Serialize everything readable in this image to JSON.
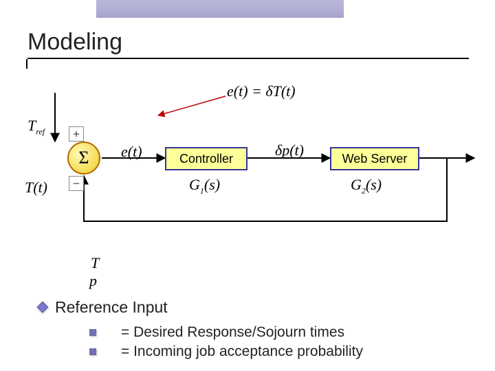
{
  "title": "Modeling",
  "diagram": {
    "sum_symbol": "Σ",
    "plus_sign": "+",
    "minus_sign": "−",
    "ref_input_label_html": "T<sub>ref</sub>",
    "feedback_label_html": "T(t)",
    "error_label_html": "e(t)",
    "error_definition_html": "e(t) = δT(t)",
    "control_signal_label_html": "δp(t)",
    "controller_label": "Controller",
    "plant_label": "Web Server",
    "controller_tf_label_html": "G<sub>1</sub>(s)",
    "plant_tf_label_html": "G<sub>2</sub>(s)"
  },
  "legend_symbols": {
    "T_html": "T",
    "p_html": "p"
  },
  "bullets": {
    "ref_heading": "Reference Input",
    "items": [
      "= Desired Response/Sojourn times",
      "= Incoming job acceptance probability"
    ]
  }
}
